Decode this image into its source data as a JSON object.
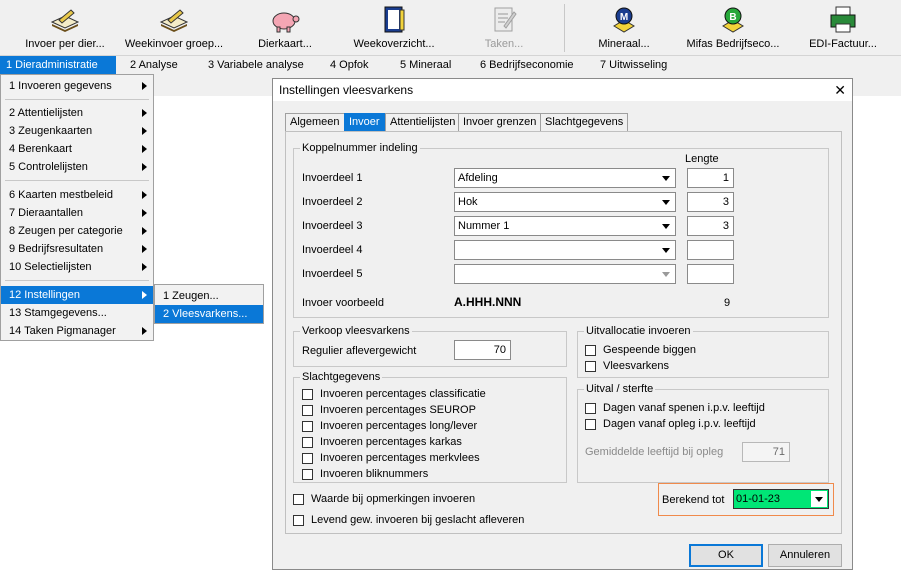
{
  "toolbar": {
    "items": [
      {
        "label": "Invoer per dier...",
        "icon": "pencil-book-icon",
        "enabled": true
      },
      {
        "label": "Weekinvoer groep...",
        "icon": "pencil-book-icon",
        "enabled": true
      },
      {
        "label": "Dierkaart...",
        "icon": "pig-icon",
        "enabled": true
      },
      {
        "label": "Weekoverzicht...",
        "icon": "notebook-icon",
        "enabled": true
      },
      {
        "label": "Taken...",
        "icon": "task-list-icon",
        "enabled": false
      },
      {
        "label": "Mineraal...",
        "icon": "mineral-m-icon",
        "enabled": true
      },
      {
        "label": "Mifas Bedrijfseco...",
        "icon": "economics-b-icon",
        "enabled": true
      },
      {
        "label": "EDI-Factuur...",
        "icon": "printer-icon",
        "enabled": true
      }
    ]
  },
  "menubar": [
    {
      "label": "1  Dieradministratie",
      "selected": true
    },
    {
      "label": "2  Analyse"
    },
    {
      "label": "3  Variabele analyse"
    },
    {
      "label": "4  Opfok"
    },
    {
      "label": "5  Mineraal"
    },
    {
      "label": "6  Bedrijfseconomie"
    },
    {
      "label": "7  Uitwisseling"
    }
  ],
  "dropdown": [
    {
      "label": "1  Invoeren gegevens",
      "submenu": true
    },
    {
      "label": "2  Attentielijsten",
      "submenu": true
    },
    {
      "label": "3  Zeugenkaarten",
      "submenu": true
    },
    {
      "label": "4  Berenkaart",
      "submenu": true
    },
    {
      "label": "5  Controlelijsten",
      "submenu": true
    },
    {
      "label": "6  Kaarten mestbeleid",
      "submenu": true
    },
    {
      "label": "7  Dieraantallen",
      "submenu": true
    },
    {
      "label": "8  Zeugen per categorie",
      "submenu": true
    },
    {
      "label": "9  Bedrijfsresultaten",
      "submenu": true
    },
    {
      "label": "10  Selectielijsten",
      "submenu": true
    },
    {
      "label": "12  Instellingen",
      "submenu": true,
      "selected": true
    },
    {
      "label": "13  Stamgegevens...",
      "submenu": false
    },
    {
      "label": "14  Taken Pigmanager",
      "submenu": true
    }
  ],
  "submenu": [
    {
      "label": "1  Zeugen..."
    },
    {
      "label": "2  Vleesvarkens...",
      "selected": true
    }
  ],
  "dialog": {
    "title": "Instellingen vleesvarkens",
    "close": "✕",
    "tabs": [
      "Algemeen",
      "Invoer",
      "Attentielijsten",
      "Invoer grenzen",
      "Slachtgegevens"
    ],
    "active_tab": "Invoer",
    "koppel": {
      "title": "Koppelnummer indeling",
      "lengte_header": "Lengte",
      "rows": [
        {
          "label": "Invoerdeel 1",
          "value": "Afdeling",
          "length": "1",
          "enabled": true
        },
        {
          "label": "Invoerdeel 2",
          "value": "Hok",
          "length": "3",
          "enabled": true
        },
        {
          "label": "Invoerdeel 3",
          "value": "Nummer 1",
          "length": "3",
          "enabled": true
        },
        {
          "label": "Invoerdeel 4",
          "value": "",
          "length": "",
          "enabled": true
        },
        {
          "label": "Invoerdeel 5",
          "value": "",
          "length": "",
          "enabled": false
        }
      ],
      "voorbeeld_label": "Invoer voorbeeld",
      "voorbeeld_value": "A.HHH.NNN",
      "voorbeeld_count": "9"
    },
    "verkoop": {
      "title": "Verkoop vleesvarkens",
      "label": "Regulier aflevergewicht",
      "value": "70"
    },
    "slacht": {
      "title": "Slachtgegevens",
      "items": [
        "Invoeren percentages classificatie",
        "Invoeren percentages SEUROP",
        "Invoeren percentages long/lever",
        "Invoeren percentages karkas",
        "Invoeren percentages merkvlees",
        "Invoeren bliknummers"
      ]
    },
    "uitvallocatie": {
      "title": "Uitvallocatie invoeren",
      "items": [
        "Gespeende biggen",
        "Vleesvarkens"
      ]
    },
    "uitval": {
      "title": "Uitval / sterfte",
      "items": [
        "Dagen vanaf spenen i.p.v. leeftijd",
        "Dagen vanaf opleg i.p.v. leeftijd"
      ],
      "gem_label": "Gemiddelde leeftijd bij opleg",
      "gem_value": "71"
    },
    "waarde_label": "Waarde bij opmerkingen invoeren",
    "levend_label": "Levend gew. invoeren bij geslacht afleveren",
    "berekend_label": "Berekend tot",
    "berekend_value": "01-01-23",
    "ok": "OK",
    "cancel": "Annuleren"
  }
}
